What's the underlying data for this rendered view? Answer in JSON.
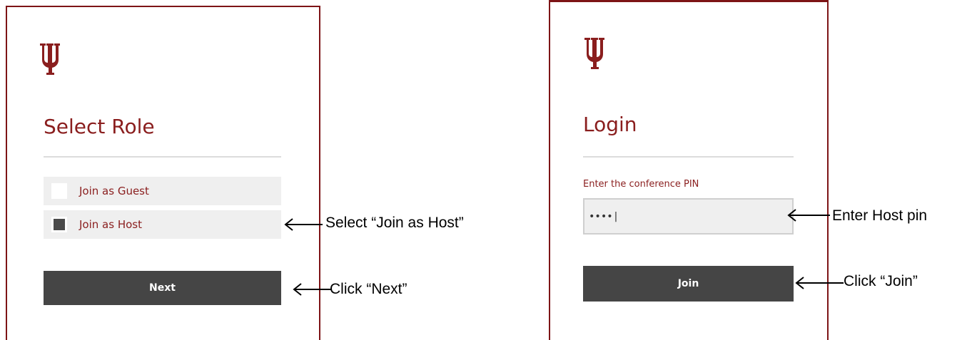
{
  "left_panel": {
    "title": "Select Role",
    "options": [
      {
        "label": "Join as Guest",
        "checked": false
      },
      {
        "label": "Join as Host",
        "checked": true
      }
    ],
    "next_button_label": "Next"
  },
  "right_panel": {
    "title": "Login",
    "pin_label": "Enter the conference PIN",
    "pin_value": "••••|",
    "join_button_label": "Join"
  },
  "annotations": {
    "select_host": "Select “Join as Host”",
    "click_next": "Click “Next”",
    "enter_pin": "Enter Host pin",
    "click_join": "Click “Join”"
  },
  "colors": {
    "brand": "#8a1e1e",
    "border": "#7d1416",
    "button": "#454545",
    "option_bg": "#efefef"
  },
  "icons": {
    "logo": "iu-trident-logo",
    "arrow": "left-arrow-icon"
  }
}
